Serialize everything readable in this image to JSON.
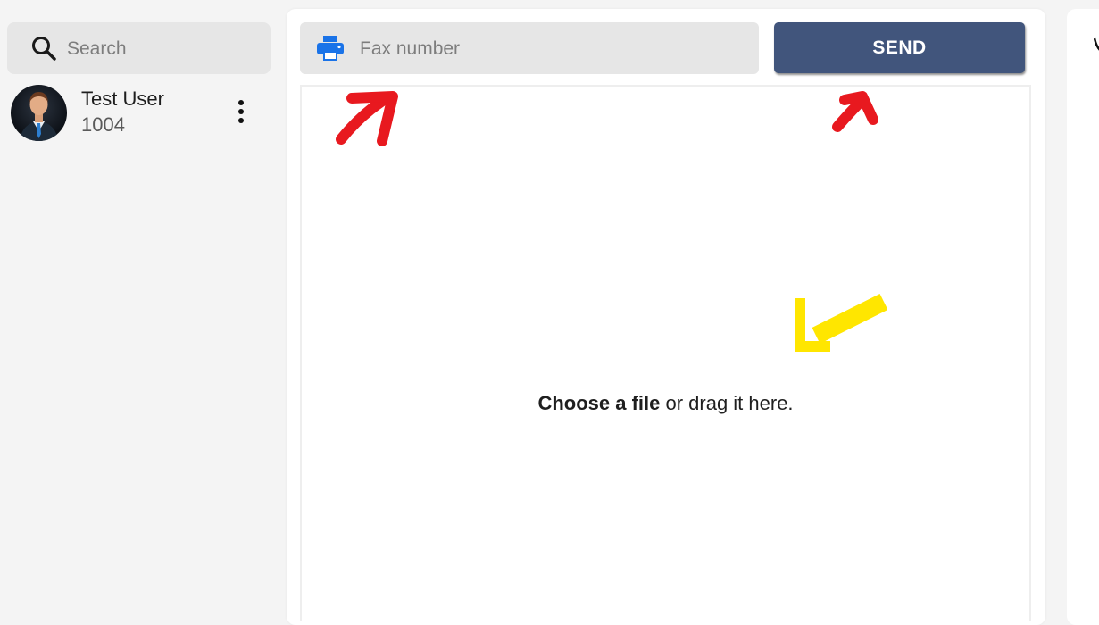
{
  "sidebar": {
    "search": {
      "placeholder": "Search",
      "icon": "search-icon"
    },
    "user": {
      "name": "Test User",
      "extension": "1004",
      "avatar_icon": "businessman-avatar",
      "menu_icon": "more-vertical-icon"
    }
  },
  "fax": {
    "number_input": {
      "placeholder": "Fax number",
      "icon": "printer-icon",
      "icon_color": "#1a73e8"
    },
    "send_button": {
      "label": "SEND",
      "color": "#41557c"
    },
    "drop_zone": {
      "choose_label": "Choose a file",
      "rest_label": " or drag it here."
    }
  },
  "annotations": {
    "arrow_colors": [
      "#e8191f",
      "#ffe600"
    ]
  }
}
